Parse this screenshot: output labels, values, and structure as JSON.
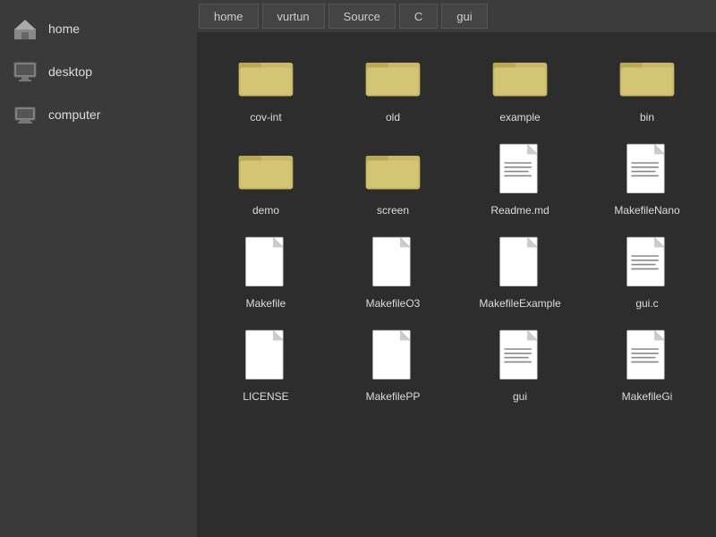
{
  "sidebar": {
    "items": [
      {
        "id": "home",
        "label": "home"
      },
      {
        "id": "desktop",
        "label": "desktop"
      },
      {
        "id": "computer",
        "label": "computer"
      }
    ]
  },
  "breadcrumb": {
    "items": [
      {
        "id": "home",
        "label": "home"
      },
      {
        "id": "vurtun",
        "label": "vurtun"
      },
      {
        "id": "source",
        "label": "Source"
      },
      {
        "id": "c",
        "label": "C"
      },
      {
        "id": "gui",
        "label": "gui"
      }
    ]
  },
  "files": [
    {
      "id": "cov-int",
      "label": "cov-int",
      "type": "folder"
    },
    {
      "id": "old",
      "label": "old",
      "type": "folder"
    },
    {
      "id": "example",
      "label": "example",
      "type": "folder"
    },
    {
      "id": "bin",
      "label": "bin",
      "type": "folder"
    },
    {
      "id": "demo",
      "label": "demo",
      "type": "folder"
    },
    {
      "id": "screen",
      "label": "screen",
      "type": "folder"
    },
    {
      "id": "readme-md",
      "label": "Readme.md",
      "type": "doc-lines"
    },
    {
      "id": "makefilenano",
      "label": "MakefileNano",
      "type": "doc-lines"
    },
    {
      "id": "makefile",
      "label": "Makefile",
      "type": "doc"
    },
    {
      "id": "makefileO3",
      "label": "MakefileO3",
      "type": "doc"
    },
    {
      "id": "makefileExample",
      "label": "MakefileExample",
      "type": "doc"
    },
    {
      "id": "gui-c",
      "label": "gui.c",
      "type": "doc-lines"
    },
    {
      "id": "license",
      "label": "LICENSE",
      "type": "doc"
    },
    {
      "id": "MakefilePP",
      "label": "MakefilePP",
      "type": "doc"
    },
    {
      "id": "unknown1",
      "label": "gui",
      "type": "doc-lines"
    },
    {
      "id": "MakefileGi",
      "label": "MakefileGi",
      "type": "doc-lines"
    }
  ]
}
